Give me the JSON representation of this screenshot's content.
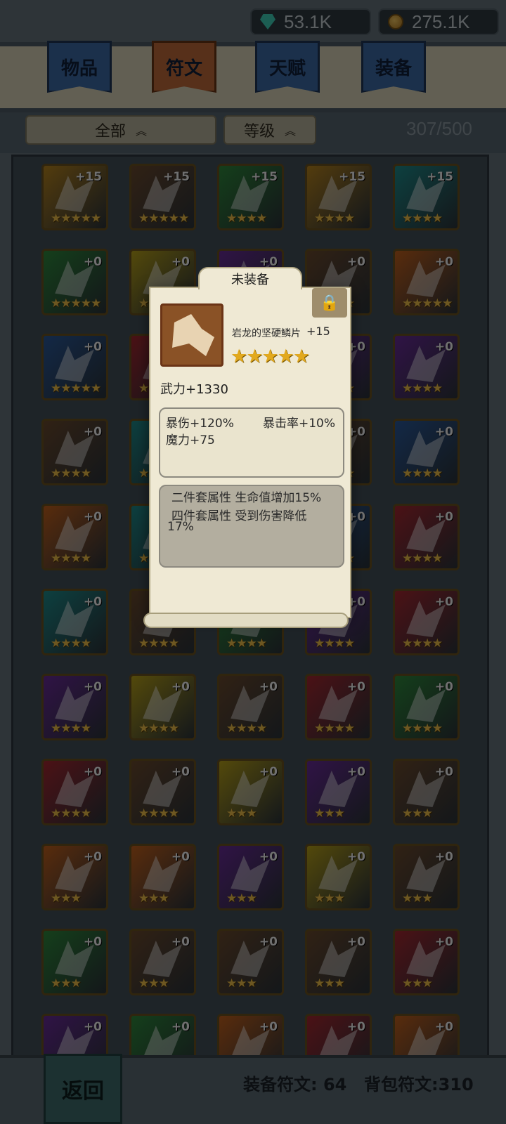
{
  "currency": {
    "gem": "53.1K",
    "gold": "275.1K"
  },
  "tabs": [
    {
      "label": "物品",
      "active": false
    },
    {
      "label": "符文",
      "active": true
    },
    {
      "label": "天赋",
      "active": false
    },
    {
      "label": "装备",
      "active": false
    }
  ],
  "filters": {
    "category": "全部",
    "sort": "等级",
    "capacity": "307/500"
  },
  "colors": {
    "gold": "#b8851f",
    "bronze": "#8a5226",
    "green": "#2f8a3c",
    "teal": "#1f8d8d",
    "blue": "#2b5a9c",
    "purple": "#6a2c9a",
    "red": "#a62831",
    "orange": "#c4621e",
    "yellow": "#b8a21a",
    "brown": "#6b4a2e",
    "star": "#f1c24a",
    "accent_tab": "#c06a3a"
  },
  "runes": [
    {
      "color": "gold",
      "level": "+15",
      "stars": "★★★★★"
    },
    {
      "color": "brown",
      "level": "+15",
      "stars": "★★★★★"
    },
    {
      "color": "green",
      "level": "+15",
      "stars": "★★★★"
    },
    {
      "color": "gold",
      "level": "+15",
      "stars": "★★★★"
    },
    {
      "color": "teal",
      "level": "+15",
      "stars": "★★★★"
    },
    {
      "color": "green",
      "level": "+0",
      "stars": "★★★★★"
    },
    {
      "color": "yellow",
      "level": "+0",
      "stars": "★★★★"
    },
    {
      "color": "purple",
      "level": "+0",
      "stars": "★★★★"
    },
    {
      "color": "brown",
      "level": "+0",
      "stars": "★★★★"
    },
    {
      "color": "orange",
      "level": "+0",
      "stars": "★★★★★"
    },
    {
      "color": "blue",
      "level": "+0",
      "stars": "★★★★★"
    },
    {
      "color": "red",
      "level": "+0",
      "stars": "★★★★"
    },
    {
      "color": "purple",
      "level": "+0",
      "stars": "★★★★"
    },
    {
      "color": "purple",
      "level": "+0",
      "stars": "★★★★"
    },
    {
      "color": "purple",
      "level": "+0",
      "stars": "★★★★"
    },
    {
      "color": "brown",
      "level": "+0",
      "stars": "★★★★"
    },
    {
      "color": "teal",
      "level": "+0",
      "stars": "★★★★"
    },
    {
      "color": "brown",
      "level": "+0",
      "stars": "★★★★"
    },
    {
      "color": "brown",
      "level": "+0",
      "stars": "★★★★"
    },
    {
      "color": "blue",
      "level": "+0",
      "stars": "★★★★"
    },
    {
      "color": "orange",
      "level": "+0",
      "stars": "★★★★"
    },
    {
      "color": "teal",
      "level": "+0",
      "stars": "★★★★"
    },
    {
      "color": "blue",
      "level": "+0",
      "stars": "★★★★"
    },
    {
      "color": "blue",
      "level": "+0",
      "stars": "★★★★"
    },
    {
      "color": "red",
      "level": "+0",
      "stars": "★★★★"
    },
    {
      "color": "teal",
      "level": "+0",
      "stars": "★★★★"
    },
    {
      "color": "brown",
      "level": "+0",
      "stars": "★★★★"
    },
    {
      "color": "green",
      "level": "+0",
      "stars": "★★★★"
    },
    {
      "color": "purple",
      "level": "+0",
      "stars": "★★★★"
    },
    {
      "color": "red",
      "level": "+0",
      "stars": "★★★★"
    },
    {
      "color": "purple",
      "level": "+0",
      "stars": "★★★★"
    },
    {
      "color": "yellow",
      "level": "+0",
      "stars": "★★★★"
    },
    {
      "color": "brown",
      "level": "+0",
      "stars": "★★★★"
    },
    {
      "color": "red",
      "level": "+0",
      "stars": "★★★★"
    },
    {
      "color": "green",
      "level": "+0",
      "stars": "★★★★"
    },
    {
      "color": "red",
      "level": "+0",
      "stars": "★★★★"
    },
    {
      "color": "brown",
      "level": "+0",
      "stars": "★★★★"
    },
    {
      "color": "yellow",
      "level": "+0",
      "stars": "★★★"
    },
    {
      "color": "purple",
      "level": "+0",
      "stars": "★★★"
    },
    {
      "color": "brown",
      "level": "+0",
      "stars": "★★★"
    },
    {
      "color": "orange",
      "level": "+0",
      "stars": "★★★"
    },
    {
      "color": "orange",
      "level": "+0",
      "stars": "★★★"
    },
    {
      "color": "purple",
      "level": "+0",
      "stars": "★★★"
    },
    {
      "color": "yellow",
      "level": "+0",
      "stars": "★★★"
    },
    {
      "color": "brown",
      "level": "+0",
      "stars": "★★★"
    },
    {
      "color": "green",
      "level": "+0",
      "stars": "★★★"
    },
    {
      "color": "brown",
      "level": "+0",
      "stars": "★★★"
    },
    {
      "color": "brown",
      "level": "+0",
      "stars": "★★★"
    },
    {
      "color": "brown",
      "level": "+0",
      "stars": "★★★"
    },
    {
      "color": "red",
      "level": "+0",
      "stars": "★★★"
    },
    {
      "color": "purple",
      "level": "+0",
      "stars": "★★★"
    },
    {
      "color": "green",
      "level": "+0",
      "stars": "★★★"
    },
    {
      "color": "orange",
      "level": "+0",
      "stars": "★★★"
    },
    {
      "color": "red",
      "level": "+0",
      "stars": "★★★"
    },
    {
      "color": "orange",
      "level": "+0",
      "stars": "★★★"
    }
  ],
  "tooltip": {
    "status": "未装备",
    "name": "岩龙的坚硬鳞片",
    "level": "+15",
    "stars": "★★★★★",
    "main_stat": "武力+1330",
    "sub_stats": {
      "crit_damage": "暴伤+120%",
      "crit_rate": "暴击率+10%",
      "magic": "魔力+75"
    },
    "set_bonus": {
      "two_piece": "二件套属性 生命值增加15%",
      "four_piece_line1": "四件套属性 受到伤害降低",
      "four_piece_line2": "17%"
    },
    "lock_icon": "lock-icon"
  },
  "footer": {
    "back": "返回",
    "equipped": "装备符文: 64",
    "bag": "背包符文:310"
  }
}
